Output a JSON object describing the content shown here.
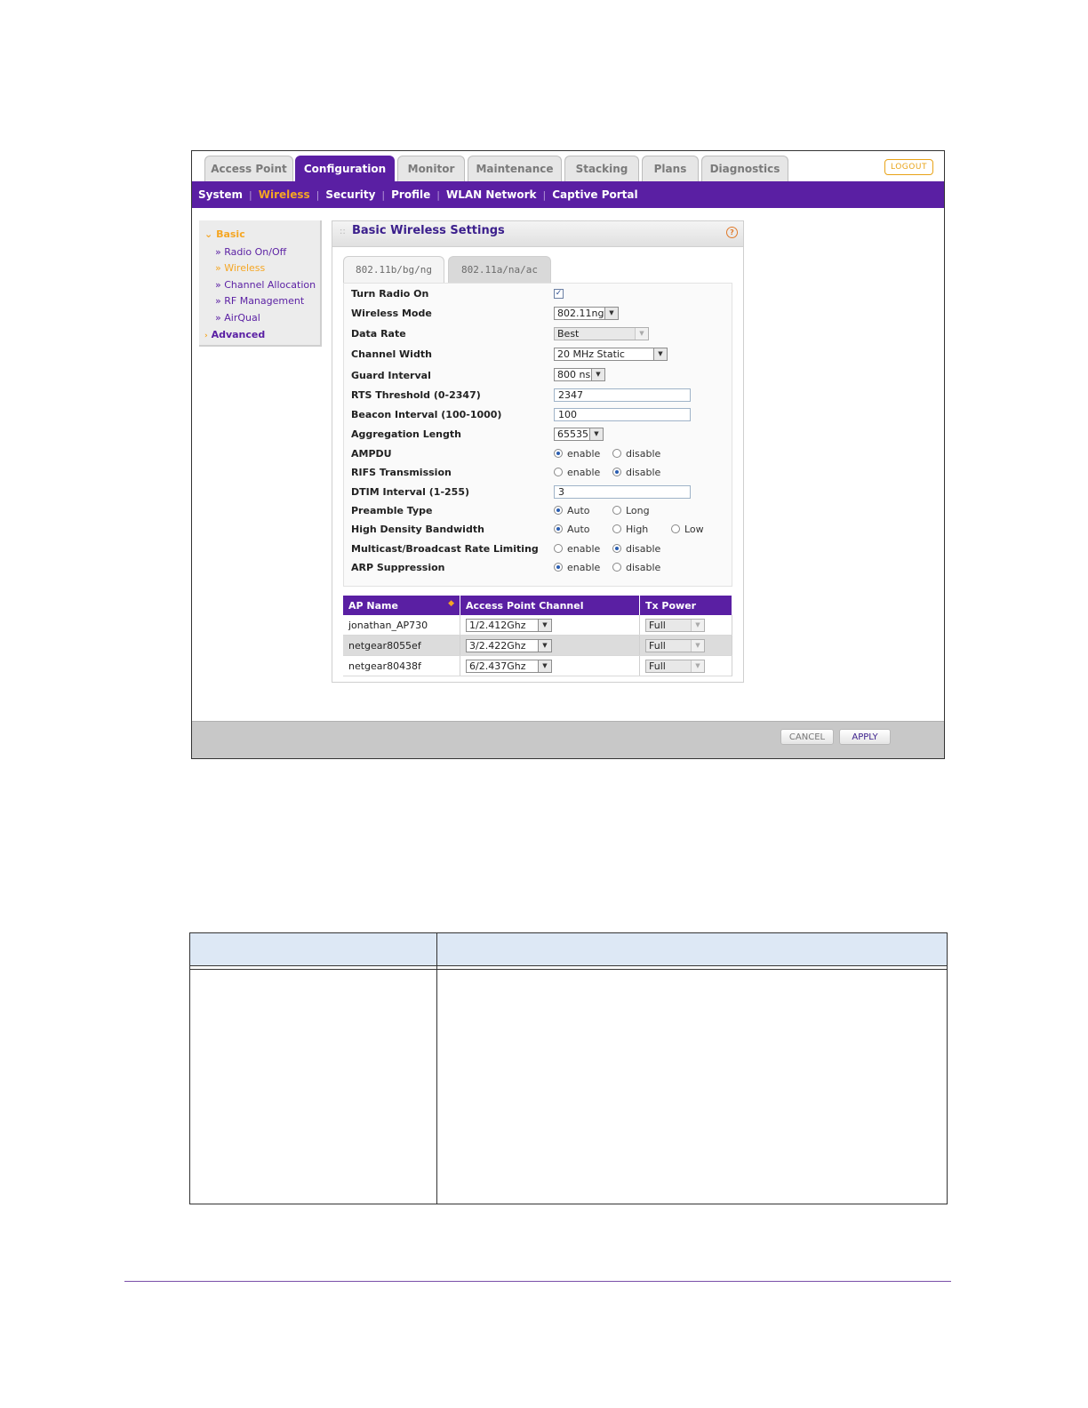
{
  "main_tabs": [
    {
      "label": "Access Point",
      "active": false
    },
    {
      "label": "Configuration",
      "active": true
    },
    {
      "label": "Monitor",
      "active": false
    },
    {
      "label": "Maintenance",
      "active": false
    },
    {
      "label": "Stacking",
      "active": false
    },
    {
      "label": "Plans",
      "active": false
    },
    {
      "label": "Diagnostics",
      "active": false
    }
  ],
  "logout_label": "LOGOUT",
  "subnav": [
    {
      "label": "System",
      "active": false
    },
    {
      "label": "Wireless",
      "active": true
    },
    {
      "label": "Security",
      "active": false
    },
    {
      "label": "Profile",
      "active": false
    },
    {
      "label": "WLAN Network",
      "active": false
    },
    {
      "label": "Captive Portal",
      "active": false
    }
  ],
  "left_menu": {
    "basic_label": "Basic",
    "items": [
      "Radio On/Off",
      "Wireless",
      "Channel Allocation",
      "RF Management",
      "AirQual"
    ],
    "active_item": "Wireless",
    "advanced_label": "Advanced"
  },
  "panel": {
    "title": "Basic Wireless Settings",
    "band_tabs": [
      "802.11b/bg/ng",
      "802.11a/na/ac"
    ],
    "active_band": "802.11b/bg/ng"
  },
  "settings": {
    "turn_radio_on": {
      "label": "Turn Radio On",
      "checked": true
    },
    "wireless_mode": {
      "label": "Wireless Mode",
      "value": "802.11ng"
    },
    "data_rate": {
      "label": "Data Rate",
      "value": "Best"
    },
    "channel_width": {
      "label": "Channel Width",
      "value": "20 MHz Static"
    },
    "guard_interval": {
      "label": "Guard Interval",
      "value": "800 ns"
    },
    "rts_threshold": {
      "label": "RTS Threshold (0-2347)",
      "value": "2347"
    },
    "beacon_interval": {
      "label": "Beacon Interval (100-1000)",
      "value": "100"
    },
    "aggregation_length": {
      "label": "Aggregation Length",
      "value": "65535"
    },
    "ampdu": {
      "label": "AMPDU",
      "opt1": "enable",
      "opt2": "disable",
      "selected": "enable"
    },
    "rifs": {
      "label": "RIFS Transmission",
      "opt1": "enable",
      "opt2": "disable",
      "selected": "disable"
    },
    "dtim_interval": {
      "label": "DTIM Interval (1-255)",
      "value": "3"
    },
    "preamble": {
      "label": "Preamble Type",
      "opt1": "Auto",
      "opt2": "Long",
      "selected": "Auto"
    },
    "hd_bandwidth": {
      "label": "High Density Bandwidth",
      "opt1": "Auto",
      "opt2": "High",
      "opt3": "Low",
      "selected": "Auto"
    },
    "multicast_limiting": {
      "label": "Multicast/Broadcast Rate Limiting",
      "opt1": "enable",
      "opt2": "disable",
      "selected": "disable"
    },
    "arp_suppression": {
      "label": "ARP Suppression",
      "opt1": "enable",
      "opt2": "disable",
      "selected": "enable"
    }
  },
  "ap_table": {
    "columns": [
      "AP Name",
      "Access Point Channel",
      "Tx Power"
    ],
    "rows": [
      {
        "name": "jonathan_AP730",
        "channel": "1/2.412Ghz",
        "power": "Full"
      },
      {
        "name": "netgear8055ef",
        "channel": "3/2.422Ghz",
        "power": "Full"
      },
      {
        "name": "netgear80438f",
        "channel": "6/2.437Ghz",
        "power": "Full"
      }
    ]
  },
  "buttons": {
    "cancel": "CANCEL",
    "apply": "APPLY"
  },
  "colors": {
    "brand_purple": "#5a1fa3",
    "accent_orange": "#f5a623",
    "doc_header": "#dde8f5"
  },
  "icons": {
    "help": "help-icon",
    "sort": "sort-icon",
    "dropdown": "chevron-down-icon",
    "checkbox": "checkbox-icon"
  }
}
